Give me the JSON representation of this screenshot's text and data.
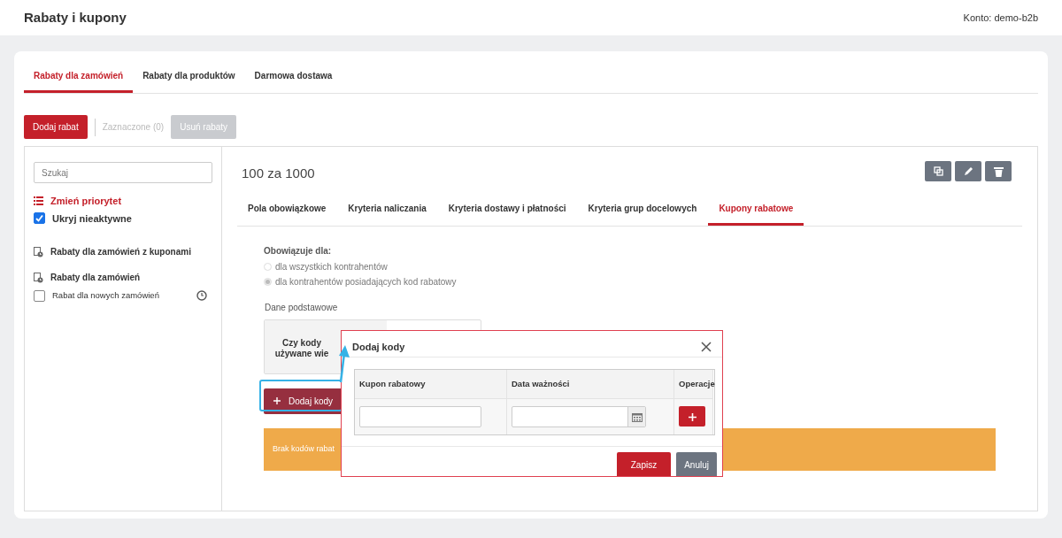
{
  "header": {
    "title": "Rabaty i kupony",
    "account": "Konto: demo-b2b"
  },
  "tabs": [
    {
      "label": "Rabaty dla zamówień",
      "selected": true
    },
    {
      "label": "Rabaty dla produktów",
      "selected": false
    },
    {
      "label": "Darmowa dostawa",
      "selected": false
    }
  ],
  "toolbar": {
    "add": "Dodaj rabat",
    "selected_count": "Zaznaczone (0)",
    "delete": "Usuń rabaty",
    "delete_disabled": true
  },
  "sidebar": {
    "search": {
      "placeholder": "Szukaj"
    },
    "priority": "Zmień priorytet",
    "hide_inactive": {
      "label": "Ukryj nieaktywne",
      "checked": true
    },
    "groups": [
      {
        "title": "Rabaty dla zamówień z kuponami"
      },
      {
        "title": "Rabaty dla zamówień",
        "items": [
          {
            "label": "Rabat dla nowych zamówień",
            "checked": false
          }
        ]
      }
    ]
  },
  "detail": {
    "title": "100 za 1000",
    "tabs": [
      {
        "label": "Pola obowiązkowe",
        "selected": false
      },
      {
        "label": "Kryteria naliczania",
        "selected": false
      },
      {
        "label": "Kryteria dostawy i płatności",
        "selected": false
      },
      {
        "label": "Kryteria grup docelowych",
        "selected": false
      },
      {
        "label": "Kupony rabatowe",
        "selected": true
      }
    ],
    "applies_label": "Obowiązuje dla:",
    "applies": [
      {
        "label": "dla wszystkich kontrahentów",
        "selected": false
      },
      {
        "label": "dla kontrahentów posiadających kod rabatowy",
        "selected": true
      }
    ],
    "section": "Dane podstawowe",
    "cell_lines": [
      "Czy kody",
      "używane wie"
    ],
    "add_codes": "Dodaj kody",
    "empty_notice": "Brak kodów rabat"
  },
  "modal": {
    "title": "Dodaj kody",
    "columns": [
      "Kupon rabatowy",
      "Data ważności",
      "Operacje"
    ],
    "save": "Zapisz",
    "cancel": "Anuluj"
  }
}
